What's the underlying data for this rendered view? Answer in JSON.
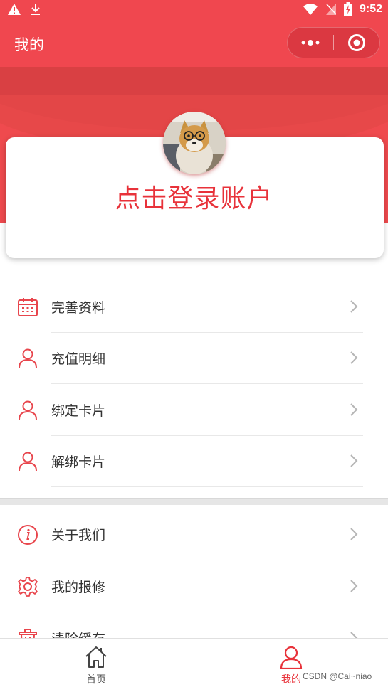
{
  "status_bar": {
    "time": "9:52"
  },
  "nav": {
    "title": "我的"
  },
  "profile": {
    "login_prompt": "点击登录账户"
  },
  "menu_group_1": [
    {
      "label": "完善资料",
      "icon": "calendar-icon"
    },
    {
      "label": "充值明细",
      "icon": "user-icon"
    },
    {
      "label": "绑定卡片",
      "icon": "user-icon"
    },
    {
      "label": "解绑卡片",
      "icon": "user-icon"
    }
  ],
  "menu_group_2": [
    {
      "label": "关于我们",
      "icon": "info-icon"
    },
    {
      "label": "我的报修",
      "icon": "gear-icon"
    },
    {
      "label": "清除缓存",
      "icon": "trash-icon"
    }
  ],
  "tabbar": {
    "home_label": "首页",
    "mine_label": "我的"
  },
  "watermark": "CSDN @Cai~niao",
  "colors": {
    "brand": "#f0474f",
    "accent_text": "#e8323a",
    "tab_active": "#e8323a"
  }
}
